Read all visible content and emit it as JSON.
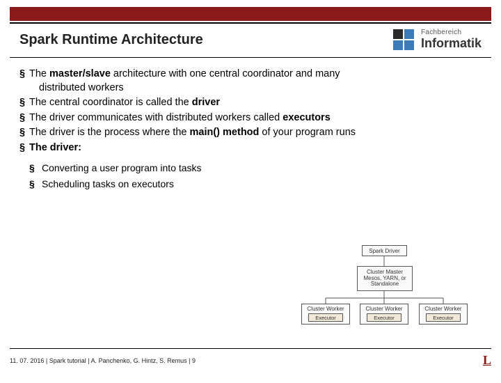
{
  "header": {
    "title": "Spark Runtime Architecture",
    "logo": {
      "line1": "Fachbereich",
      "line2": "Informatik"
    }
  },
  "bullets": [
    {
      "parts": [
        "The ",
        "master/slave",
        " architecture with one central coordinator and many"
      ],
      "bold": [
        1
      ]
    },
    {
      "parts": [
        "distributed workers"
      ],
      "indent": true
    },
    {
      "parts": [
        "The central coordinator is called the ",
        "driver"
      ],
      "bold": [
        1
      ]
    },
    {
      "parts": [
        "The driver communicates with distributed workers called ",
        "executors"
      ],
      "bold": [
        1
      ]
    },
    {
      "parts": [
        "The driver is the process where the ",
        "main() method",
        " of your program runs"
      ],
      "bold": [
        1
      ]
    },
    {
      "parts": [
        "The driver:"
      ],
      "boldAll": true
    }
  ],
  "sub_bullets": [
    "Converting a user program into tasks",
    "Scheduling tasks on executors"
  ],
  "diagram": {
    "driver": "Spark Driver",
    "master": "Cluster Master\nMesos, YARN, or\nStandalone",
    "worker": "Cluster Worker",
    "executor": "Executor"
  },
  "footer": {
    "left": "11. 07. 2016  |  Spark tutorial  |   A. Panchenko, G. Hintz, S. Remus   |  9",
    "right": "L"
  }
}
